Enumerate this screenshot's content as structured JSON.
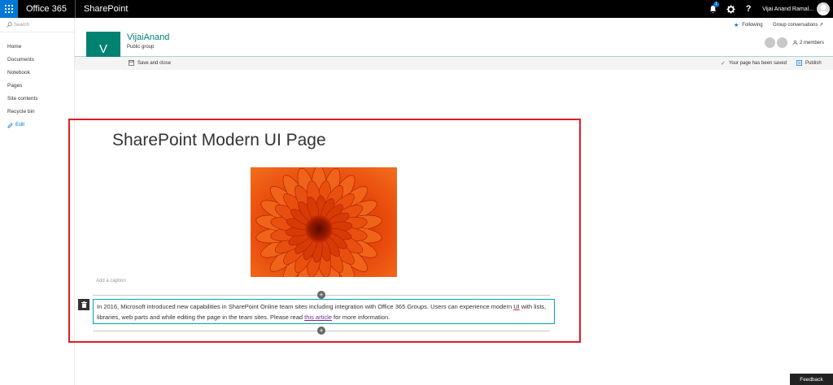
{
  "suitebar": {
    "brand": "Office 365",
    "app_name": "SharePoint",
    "notification_count": "1",
    "help_glyph": "?",
    "user_name": "Vijai Anand Ramal...",
    "accent_color": "#0078d7",
    "icons": [
      "app-launcher-icon",
      "bell-icon",
      "gear-icon",
      "help-icon",
      "user-avatar"
    ]
  },
  "search": {
    "placeholder": "Search"
  },
  "leftnav": {
    "items": [
      {
        "label": "Home"
      },
      {
        "label": "Documents"
      },
      {
        "label": "Notebook"
      },
      {
        "label": "Pages"
      },
      {
        "label": "Site contents"
      },
      {
        "label": "Recycle bin"
      }
    ],
    "edit_label": "Edit"
  },
  "site": {
    "logo_letter": "V",
    "title": "VijaiAnand",
    "subtitle": "Public group",
    "following_label": "Following",
    "group_conversations_label": "Group conversations ↗",
    "members_label": "2 members",
    "theme_color": "#008272"
  },
  "commandbar": {
    "save_close_label": "Save and close",
    "saved_status": "Your page has been saved",
    "publish_label": "Publish"
  },
  "page": {
    "title": "SharePoint Modern UI Page",
    "caption_placeholder": "Add a caption",
    "text_before_ui": "In 2016, Microsoft introduced new capabilities in SharePoint Online team sites including integration with Office 365 Groups. Users can experience modern ",
    "text_ui": "UI",
    "text_after_ui": " with lists, libraries, web parts and while editing the page in the team sites. Please read ",
    "link_text": "this article",
    "text_end": " for more information."
  },
  "feedback_label": "Feedback"
}
